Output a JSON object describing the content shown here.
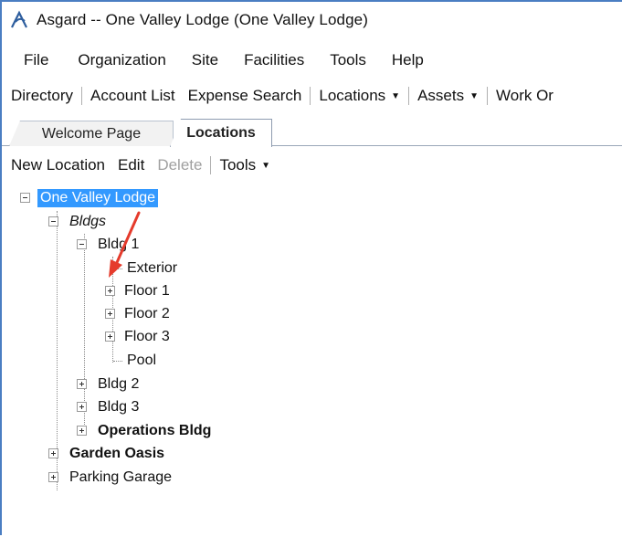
{
  "window": {
    "title": "Asgard -- One Valley Lodge (One Valley Lodge)",
    "icon": "app-logo-icon"
  },
  "menu": [
    "File",
    "Organization",
    "Site",
    "Facilities",
    "Tools",
    "Help"
  ],
  "toolbar": {
    "directory": "Directory",
    "account_list": "Account List",
    "expense_search": "Expense Search",
    "locations": "Locations",
    "assets": "Assets",
    "work_orders": "Work Or"
  },
  "tabs": {
    "welcome": "Welcome Page",
    "locations": "Locations"
  },
  "loc_toolbar": {
    "new_location": "New Location",
    "edit": "Edit",
    "delete": "Delete",
    "tools": "Tools"
  },
  "tree": {
    "root": "One Valley Lodge",
    "bldgs": "Bldgs",
    "bldg1": "Bldg 1",
    "exterior": "Exterior",
    "floor1": "Floor 1",
    "floor2": "Floor 2",
    "floor3": "Floor 3",
    "pool": "Pool",
    "bldg2": "Bldg 2",
    "bldg3": "Bldg 3",
    "operations": "Operations Bldg",
    "garden": "Garden Oasis",
    "parking": "Parking Garage"
  },
  "colors": {
    "selection": "#3399ff",
    "window_border": "#4a7ec2",
    "annotation_arrow": "#e53b2c"
  }
}
